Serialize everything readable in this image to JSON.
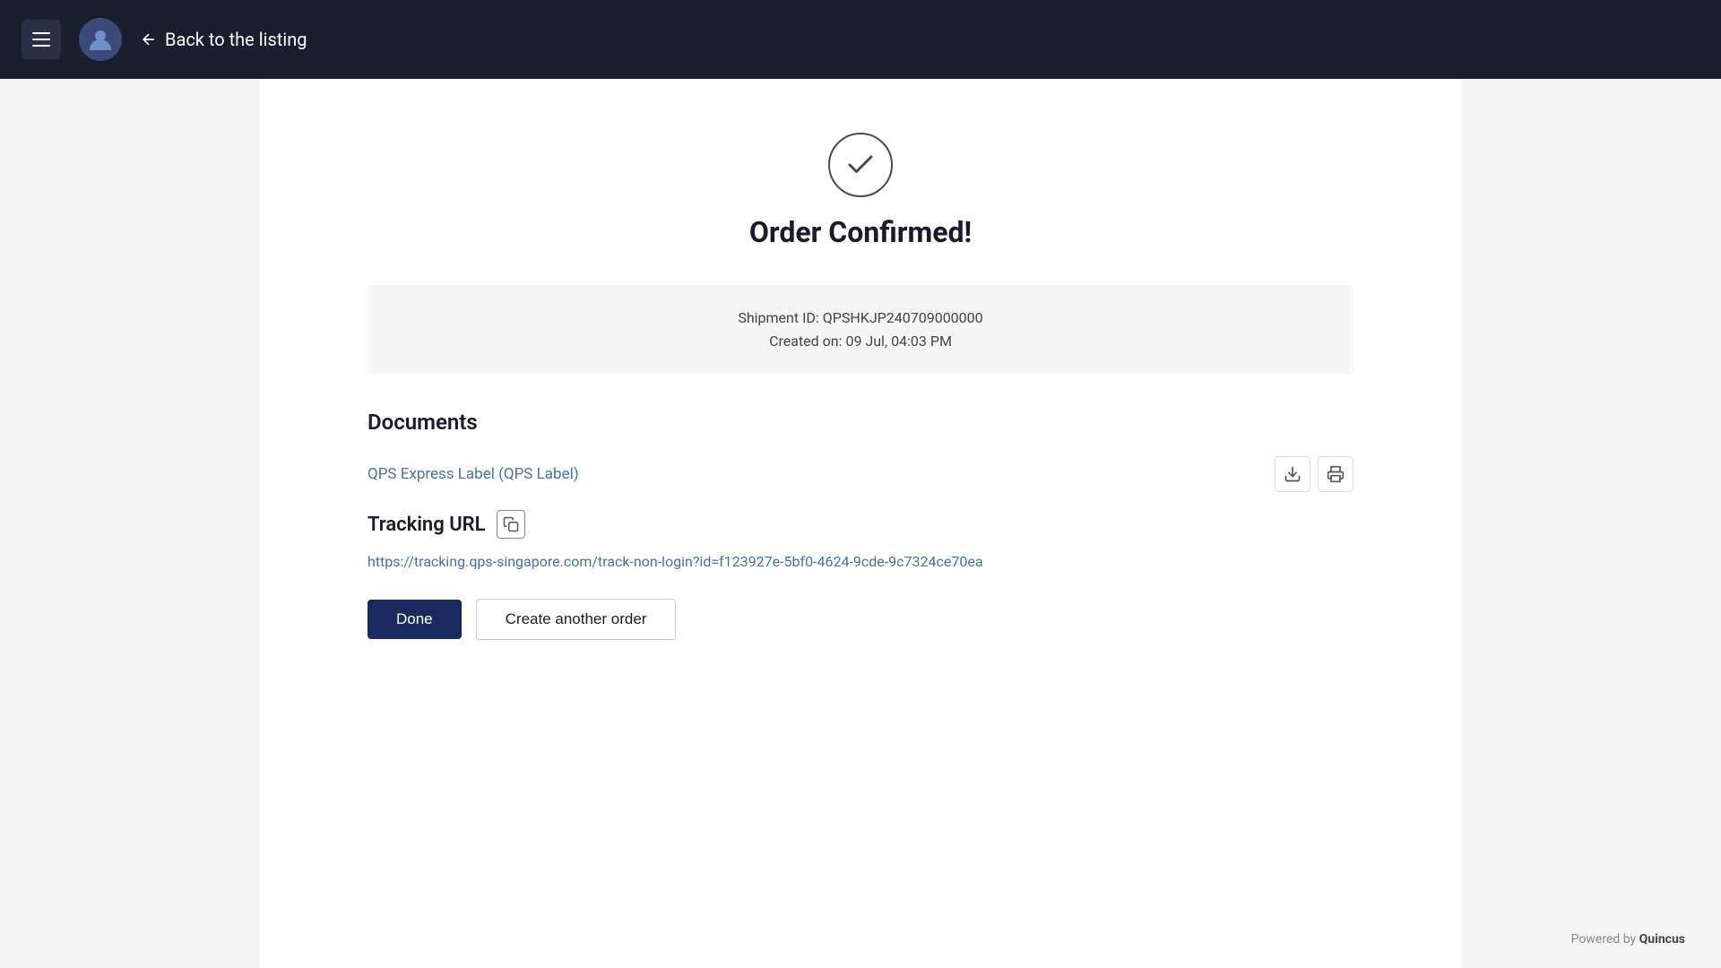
{
  "navbar": {
    "back_label": "Back to the listing"
  },
  "page": {
    "success_icon_alt": "check-circle-icon",
    "order_confirmed_title": "Order Confirmed!",
    "shipment_id_label": "Shipment ID: QPSHKJP240709000000",
    "created_on_label": "Created on: 09 Jul, 04:03 PM",
    "documents_title": "Documents",
    "qps_label_link": "QPS Express Label (QPS Label)",
    "tracking_url_label": "Tracking URL",
    "tracking_url": "https://tracking.qps-singapore.com/track-non-login?id=f123927e-5bf0-4624-9cde-9c7324ce70ea",
    "done_btn_label": "Done",
    "create_order_btn_label": "Create another order"
  },
  "footer": {
    "powered_by": "Powered by ",
    "brand": "Quincus"
  }
}
